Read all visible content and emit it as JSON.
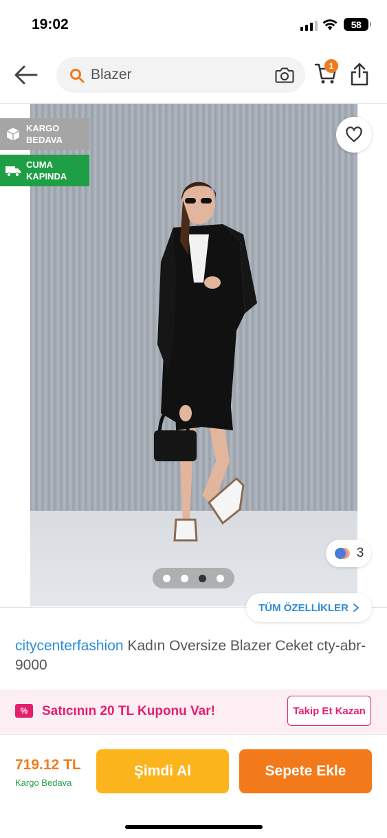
{
  "status_bar": {
    "time": "19:02",
    "battery": "58"
  },
  "nav": {
    "search_placeholder": "Blazer",
    "cart_count": "1"
  },
  "badges": {
    "cargo": [
      "KARGO",
      "BEDAVA"
    ],
    "cuma": [
      "CUMA",
      "KAPINDA"
    ]
  },
  "gallery": {
    "variant_count": "3",
    "image_count": 4,
    "active_index": 2,
    "all_features_label": "TÜM ÖZELLİKLER"
  },
  "product": {
    "brand": "citycenterfashion",
    "title": "Kadın Oversize Blazer Ceket cty-abr-9000"
  },
  "coupon": {
    "icon_text": "%",
    "text": "Satıcının 20 TL Kuponu Var!",
    "follow_label": "Takip Et Kazan"
  },
  "purchase": {
    "price": "719.12 TL",
    "shipping": "Kargo Bedava",
    "buy_now_label": "Şimdi Al",
    "add_to_cart_label": "Sepete Ekle"
  },
  "colors": {
    "accent": "#f27a1a",
    "buy_now": "#fbb41b",
    "link": "#2b8dd8",
    "coupon": "#e61e6e",
    "success": "#1f9f45"
  }
}
